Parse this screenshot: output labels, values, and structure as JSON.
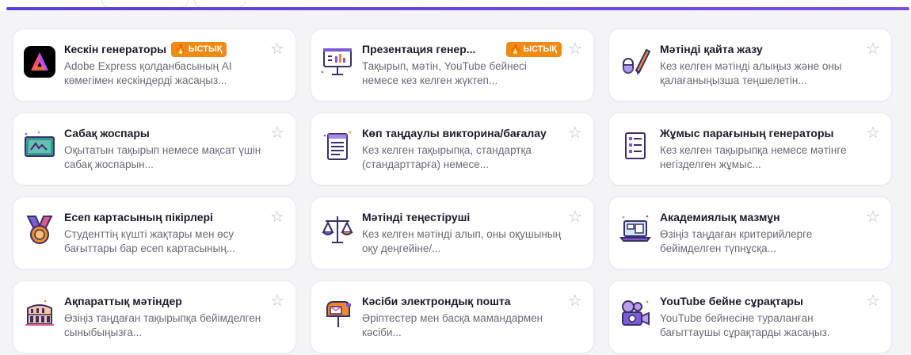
{
  "badge_label": "ЫСТЫҚ",
  "cards": [
    {
      "title": "Кескін генераторы",
      "desc": "Adobe Express қолданбасының AI көмегімен кескіндерді жасаңыз...",
      "hot": true,
      "icon": "adobe-express-icon"
    },
    {
      "title": "Презентация генер...",
      "desc": "Тақырып, мәтін, YouTube бейнесі немесе кез келген жүктеп...",
      "hot": true,
      "icon": "presentation-board-icon"
    },
    {
      "title": "Мәтінді қайта жазу",
      "desc": "Кез келген мәтінді алыңыз және оны қалағаныңызша теңшелетін...",
      "hot": false,
      "icon": "pencil-eraser-icon"
    },
    {
      "title": "Сабақ жоспары",
      "desc": "Оқытатын тақырып немесе мақсат үшін сабақ жоспарын...",
      "hot": false,
      "icon": "chalkboard-icon"
    },
    {
      "title": "Көп таңдаулы викторина/бағалау",
      "desc": "Кез келген тақырыпқа, стандартқа (стандарттарға) немесе...",
      "hot": false,
      "icon": "quiz-document-icon"
    },
    {
      "title": "Жұмыс парағының генераторы",
      "desc": "Кез келген тақырыпқа немесе мәтінге негізделген жұмыс...",
      "hot": false,
      "icon": "worksheet-icon"
    },
    {
      "title": "Есеп картасының пікірлері",
      "desc": "Студенттің күшті жақтары мен өсу бағыттары бар есеп картасының...",
      "hot": false,
      "icon": "medal-icon"
    },
    {
      "title": "Мәтінді теңестіруші",
      "desc": "Кез келген мәтінді алып, оны оқушының оқу деңгейіне/...",
      "hot": false,
      "icon": "balance-scale-icon"
    },
    {
      "title": "Академиялық мазмұн",
      "desc": "Өзіңіз таңдаған критерийлерге бейімделген түпнұсқа...",
      "hot": false,
      "icon": "laptop-icon"
    },
    {
      "title": "Ақпараттық мәтіндер",
      "desc": "Өзіңіз таңдаған тақырыпқа бейімделген сыныбыңызға...",
      "hot": false,
      "icon": "colosseum-icon"
    },
    {
      "title": "Кәсіби электрондық пошта",
      "desc": "Әріптестер мен басқа мамандармен кәсіби...",
      "hot": false,
      "icon": "mailbox-icon"
    },
    {
      "title": "YouTube бейне сұрақтары",
      "desc": "YouTube бейнесіне тураланған бағыттаушы сұрақтарды жасаңыз.",
      "hot": false,
      "icon": "video-camera-icon"
    }
  ],
  "colors": {
    "accent": "#6a45dc",
    "badge": "#ef8a14",
    "icon_purple": "#7c5bd6",
    "icon_orange": "#f08a2a"
  }
}
